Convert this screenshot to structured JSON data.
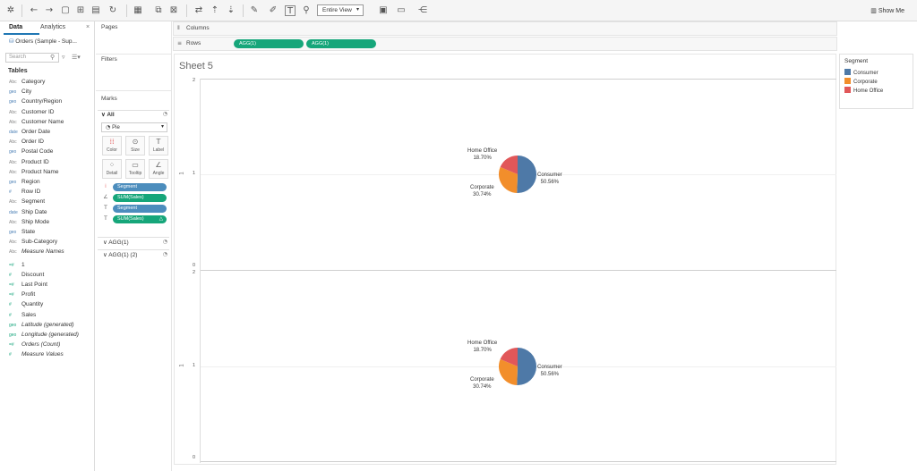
{
  "toolbar": {
    "view_mode": "Entire View",
    "show_me": "Show Me"
  },
  "data_pane": {
    "tab_data": "Data",
    "tab_analytics": "Analytics",
    "datasource": "Orders (Sample - Sup...",
    "search_placeholder": "Search",
    "tables_heading": "Tables",
    "dimensions": [
      {
        "type": "Abc",
        "name": "Category"
      },
      {
        "type": "geo",
        "name": "City"
      },
      {
        "type": "geo",
        "name": "Country/Region"
      },
      {
        "type": "Abc",
        "name": "Customer ID"
      },
      {
        "type": "Abc",
        "name": "Customer Name"
      },
      {
        "type": "date",
        "name": "Order Date"
      },
      {
        "type": "Abc",
        "name": "Order ID"
      },
      {
        "type": "geo",
        "name": "Postal Code"
      },
      {
        "type": "Abc",
        "name": "Product ID"
      },
      {
        "type": "Abc",
        "name": "Product Name"
      },
      {
        "type": "geo",
        "name": "Region"
      },
      {
        "type": "#",
        "name": "Row ID"
      },
      {
        "type": "Abc",
        "name": "Segment"
      },
      {
        "type": "date",
        "name": "Ship Date"
      },
      {
        "type": "Abc",
        "name": "Ship Mode"
      },
      {
        "type": "geo",
        "name": "State"
      },
      {
        "type": "Abc",
        "name": "Sub-Category"
      },
      {
        "type": "Abc",
        "name": "Measure Names"
      }
    ],
    "measures": [
      {
        "type": "=#",
        "name": "1"
      },
      {
        "type": "#",
        "name": "Discount"
      },
      {
        "type": "=#",
        "name": "Last Point"
      },
      {
        "type": "=#",
        "name": "Profit"
      },
      {
        "type": "#",
        "name": "Quantity"
      },
      {
        "type": "#",
        "name": "Sales"
      },
      {
        "type": "geo",
        "name": "Latitude (generated)"
      },
      {
        "type": "geo",
        "name": "Longitude (generated)"
      },
      {
        "type": "=#",
        "name": "Orders (Count)"
      },
      {
        "type": "#",
        "name": "Measure Values"
      }
    ]
  },
  "cards": {
    "pages": "Pages",
    "filters": "Filters",
    "marks": "Marks",
    "marks_all": "All",
    "mark_type": "Pie",
    "buttons": [
      "Color",
      "Size",
      "Label",
      "Detail",
      "Tooltip",
      "Angle"
    ],
    "pills": [
      "Segment",
      "SUM(Sales)",
      "Segment",
      "SUM(Sales)"
    ],
    "agg_rows": [
      "AGG(1)",
      "AGG(1) (2)"
    ]
  },
  "shelves": {
    "columns_label": "Columns",
    "rows_label": "Rows",
    "row_pills": [
      "AGG(1)",
      "AGG(1)"
    ]
  },
  "sheet": {
    "title": "Sheet 5"
  },
  "axis": {
    "ticks": [
      "2",
      "1",
      "0"
    ],
    "title": "1"
  },
  "legend": {
    "title": "Segment",
    "items": [
      {
        "name": "Consumer",
        "color": "#4e79a7"
      },
      {
        "name": "Corporate",
        "color": "#f28e2b"
      },
      {
        "name": "Home Office",
        "color": "#e15759"
      }
    ]
  },
  "chart_data": [
    {
      "type": "pie",
      "categories": [
        "Consumer",
        "Corporate",
        "Home Office"
      ],
      "values": [
        50.56,
        30.74,
        18.7
      ],
      "labels": [
        {
          "name": "Consumer",
          "pct": "50.56%"
        },
        {
          "name": "Corporate",
          "pct": "30.74%"
        },
        {
          "name": "Home Office",
          "pct": "18.70%"
        }
      ]
    },
    {
      "type": "pie",
      "categories": [
        "Consumer",
        "Corporate",
        "Home Office"
      ],
      "values": [
        50.56,
        30.74,
        18.7
      ],
      "labels": [
        {
          "name": "Consumer",
          "pct": "50.56%"
        },
        {
          "name": "Corporate",
          "pct": "30.74%"
        },
        {
          "name": "Home Office",
          "pct": "18.70%"
        }
      ]
    }
  ]
}
